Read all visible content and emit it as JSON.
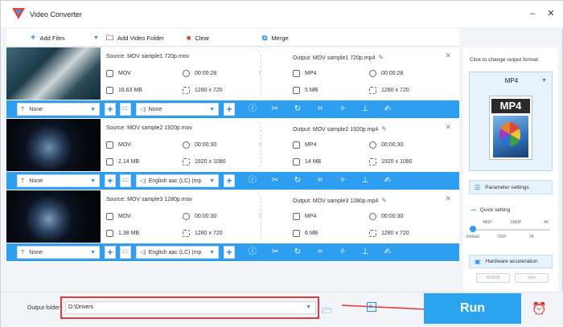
{
  "app": {
    "title": "Video Converter"
  },
  "toolbar": {
    "add_files": "Add Files",
    "add_video_folder": "Add Video Folder",
    "clear": "Clear",
    "merge": "Merge"
  },
  "files": [
    {
      "source_name": "Source: MOV sample1 720p.mov",
      "src_format": "MOV",
      "src_duration": "00:00:28",
      "src_size": "16.63 MB",
      "src_resolution": "1280 x 720",
      "output_name": "Output: MOV sample1 720p.mp4",
      "out_format": "MP4",
      "out_duration": "00:00:28",
      "out_size": "5 MB",
      "out_resolution": "1280 x 720",
      "subtitle": "None",
      "audio": "None"
    },
    {
      "source_name": "Source: MOV sample2 1920p.mov",
      "src_format": "MOV",
      "src_duration": "00:00:30",
      "src_size": "2.14 MB",
      "src_resolution": "1920 x 1080",
      "output_name": "Output: MOV sample2 1920p.mp4",
      "out_format": "MP4",
      "out_duration": "00:00:30",
      "out_size": "14 MB",
      "out_resolution": "1920 x 1080",
      "subtitle": "None",
      "audio": "English aac (LC) (mp"
    },
    {
      "source_name": "Source: MOV sample3 1280p.mov",
      "src_format": "MOV",
      "src_duration": "00:00:30",
      "src_size": "1.38 MB",
      "src_resolution": "1280 x 720",
      "output_name": "Output: MOV sample3 1280p.mp4",
      "out_format": "MP4",
      "out_duration": "00:00:30",
      "out_size": "6 MB",
      "out_resolution": "1280 x 720",
      "subtitle": "None",
      "audio": "English aac (LC) (mp"
    }
  ],
  "right_panel": {
    "hint": "Click to change output format:",
    "format": "MP4",
    "card_title": "MP4",
    "parameter_settings": "Parameter settings",
    "quick_setting": "Quick setting",
    "ticks_top": [
      "480P",
      "1080P",
      "4K"
    ],
    "ticks_bottom": [
      "Default",
      "720P",
      "2K"
    ],
    "hardware_acceleration": "Hardware acceleration",
    "gpu_nvidia": "NVIDIA",
    "gpu_intel": "Intel"
  },
  "bottom": {
    "output_folder_label": "Output folder:",
    "output_folder_value": "D:\\Drivers",
    "run": "Run"
  },
  "colors": {
    "accent": "#2e9ef0",
    "run_button": "#2ba4f0",
    "highlight_red": "#e13b3b"
  }
}
